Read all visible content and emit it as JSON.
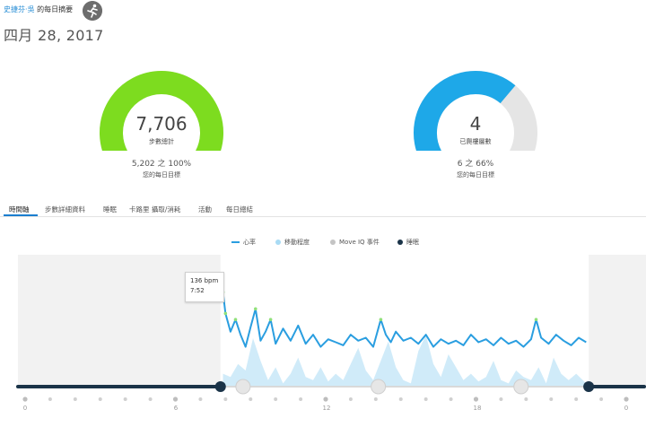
{
  "header": {
    "user_name": "史捷芬·吳",
    "title_suffix": " 的每日摘要",
    "date": "四月 28, 2017"
  },
  "gauges": [
    {
      "value": "7,706",
      "label": "步數總計",
      "progress_text": "5,202 之 100%",
      "goal_text": "您的每日目標",
      "fraction": 1.0,
      "color": "#7ddc1f",
      "track_color": "#e5e5e5"
    },
    {
      "value": "4",
      "label": "已爬樓層數",
      "progress_text": "6 之 66%",
      "goal_text": "您的每日目標",
      "fraction": 0.667,
      "color": "#1ea8e8",
      "track_color": "#e5e5e5"
    }
  ],
  "tabs": [
    "時間軸",
    "步數詳細資料",
    "睡眠",
    "卡路里 攝取/消耗",
    "活動",
    "每日總結"
  ],
  "legend": [
    {
      "label": "心率",
      "color": "#2a9ee0",
      "kind": "line"
    },
    {
      "label": "移動程度",
      "color": "#a9dbf4",
      "kind": "dot"
    },
    {
      "label": "Move IQ 事件",
      "color": "#c4c4c4",
      "kind": "dot"
    },
    {
      "label": "睡眠",
      "color": "#1a3348",
      "kind": "dot"
    }
  ],
  "tooltip": {
    "value": "136 bpm",
    "time": "7:52"
  },
  "chart_data": {
    "type": "line",
    "x_ticks": [
      "0",
      "6",
      "12",
      "18",
      "0"
    ],
    "series": [
      {
        "name": "心率",
        "color": "#2a9ee0",
        "x": [
          7.9,
          8.0,
          8.2,
          8.4,
          8.6,
          8.8,
          9.0,
          9.2,
          9.4,
          9.6,
          9.8,
          10.0,
          10.3,
          10.6,
          10.9,
          11.2,
          11.5,
          11.8,
          12.1,
          12.4,
          12.7,
          13.0,
          13.3,
          13.6,
          13.9,
          14.2,
          14.4,
          14.6,
          14.8,
          15.1,
          15.4,
          15.7,
          16.0,
          16.3,
          16.6,
          16.9,
          17.2,
          17.5,
          17.8,
          18.1,
          18.4,
          18.7,
          19.0,
          19.3,
          19.6,
          19.9,
          20.2,
          20.4,
          20.6,
          20.9,
          21.2,
          21.5,
          21.8,
          22.1,
          22.4
        ],
        "y": [
          136,
          122,
          110,
          118,
          108,
          100,
          113,
          125,
          104,
          110,
          118,
          102,
          112,
          104,
          114,
          102,
          108,
          100,
          105,
          103,
          101,
          108,
          104,
          106,
          100,
          118,
          108,
          103,
          110,
          104,
          106,
          102,
          108,
          100,
          105,
          102,
          104,
          101,
          108,
          103,
          105,
          101,
          106,
          102,
          104,
          100,
          105,
          118,
          106,
          102,
          108,
          104,
          101,
          106,
          103
        ]
      },
      {
        "name": "移動程度",
        "color": "#a9dbf4",
        "x": [
          7.9,
          8.2,
          8.5,
          8.8,
          9.1,
          9.4,
          9.7,
          10.0,
          10.3,
          10.6,
          10.9,
          11.2,
          11.5,
          11.8,
          12.1,
          12.4,
          12.7,
          13.0,
          13.3,
          13.6,
          13.9,
          14.2,
          14.5,
          14.8,
          15.1,
          15.4,
          15.7,
          16.0,
          16.3,
          16.6,
          16.9,
          17.2,
          17.5,
          17.8,
          18.1,
          18.4,
          18.7,
          19.0,
          19.3,
          19.6,
          19.9,
          20.2,
          20.5,
          20.8,
          21.1,
          21.4,
          21.7,
          22.0,
          22.4
        ],
        "y": [
          0.2,
          0.15,
          0.35,
          0.25,
          0.75,
          0.4,
          0.1,
          0.3,
          0.05,
          0.2,
          0.45,
          0.15,
          0.1,
          0.3,
          0.08,
          0.2,
          0.1,
          0.35,
          0.6,
          0.25,
          0.1,
          0.4,
          0.7,
          0.3,
          0.1,
          0.05,
          0.55,
          0.8,
          0.35,
          0.15,
          0.5,
          0.3,
          0.1,
          0.2,
          0.08,
          0.15,
          0.4,
          0.1,
          0.05,
          0.25,
          0.15,
          0.1,
          0.3,
          0.05,
          0.45,
          0.2,
          0.1,
          0.2,
          0.05
        ]
      }
    ],
    "xlim": [
      0,
      24
    ],
    "ylim": [
      85,
      150
    ],
    "sleep_ranges": [
      [
        0,
        7.8
      ],
      [
        22.5,
        24
      ]
    ]
  }
}
